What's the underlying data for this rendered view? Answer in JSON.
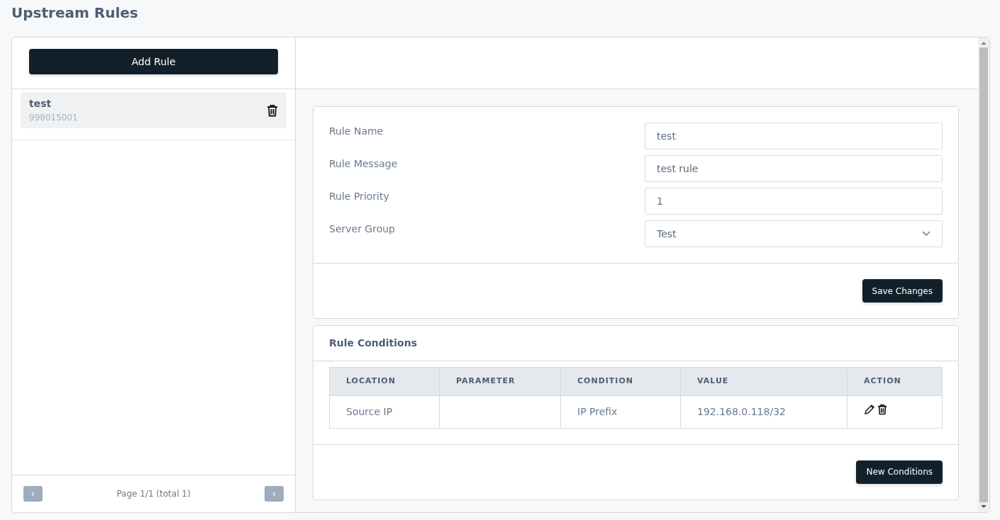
{
  "page_title": "Upstream Rules",
  "sidebar": {
    "add_button": "Add Rule",
    "rules": [
      {
        "name": "test",
        "id": "998015001",
        "selected": true
      }
    ],
    "pagination": {
      "prev": {
        "label": "‹",
        "disabled": true
      },
      "info": "Page 1/1 (total 1)",
      "next": {
        "label": "›",
        "disabled": true
      }
    }
  },
  "rule_form": {
    "fields": [
      {
        "kind": "text",
        "label": "Rule Name",
        "value": "test"
      },
      {
        "kind": "text",
        "label": "Rule Message",
        "value": "test rule"
      },
      {
        "kind": "text",
        "label": "Rule Priority",
        "value": "1"
      },
      {
        "kind": "select",
        "label": "Server Group",
        "value": "Test"
      }
    ],
    "save_button": "Save Changes"
  },
  "conditions": {
    "title": "Rule Conditions",
    "columns": [
      "LOCATION",
      "PARAMETER",
      "CONDITION",
      "VALUE",
      "ACTION"
    ],
    "rows": [
      {
        "location": "Source IP",
        "parameter": "",
        "condition": "IP Prefix",
        "value": "192.168.0.118/32"
      }
    ],
    "new_button": "New Conditions"
  }
}
